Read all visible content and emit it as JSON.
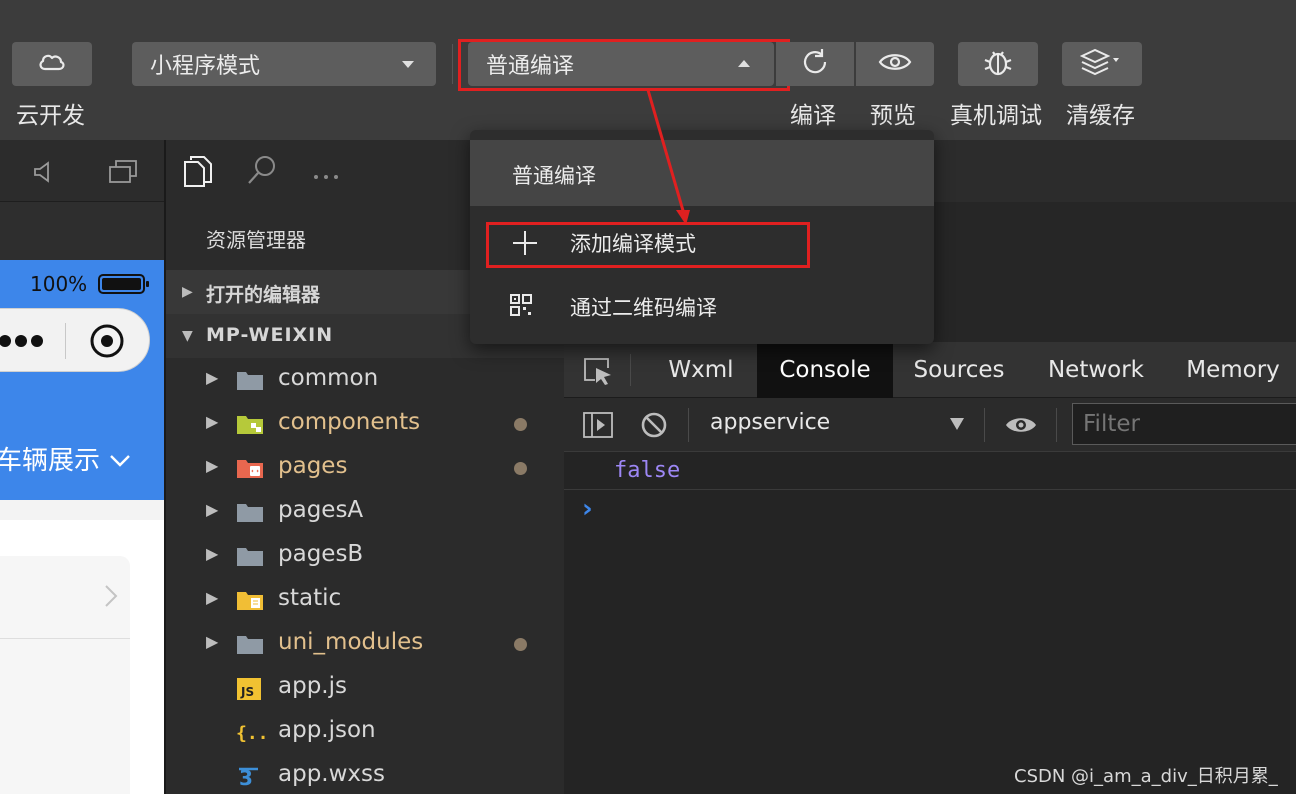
{
  "toolbar": {
    "cloud_dev_label": "云开发",
    "mode_select": "小程序模式",
    "compile_select": "普通编译",
    "compile_label": "编译",
    "preview_label": "预览",
    "debug_label": "真机调试",
    "cache_label": "清缓存"
  },
  "dropdown": {
    "header": "普通编译",
    "items": [
      {
        "label": "添加编译模式",
        "icon": "plus-icon"
      },
      {
        "label": "通过二维码编译",
        "icon": "qrcode-icon"
      }
    ]
  },
  "simulator": {
    "battery_percent": "100%",
    "header_title": "车辆展示",
    "header_icon": "chevron-down-icon"
  },
  "explorer": {
    "title": "资源管理器",
    "open_editors": "打开的编辑器",
    "project_name": "MP-WEIXIN",
    "files": [
      {
        "name": "common",
        "kind": "folder",
        "color": "#d8d8d8",
        "modified": false
      },
      {
        "name": "components",
        "kind": "folder-components",
        "color": "#e2c08d",
        "modified": true
      },
      {
        "name": "pages",
        "kind": "folder-pages",
        "color": "#e2c08d",
        "modified": true
      },
      {
        "name": "pagesA",
        "kind": "folder",
        "color": "#d8d8d8",
        "modified": false
      },
      {
        "name": "pagesB",
        "kind": "folder",
        "color": "#d8d8d8",
        "modified": false
      },
      {
        "name": "static",
        "kind": "folder-static",
        "color": "#d8d8d8",
        "modified": false
      },
      {
        "name": "uni_modules",
        "kind": "folder",
        "color": "#e2c08d",
        "modified": true
      },
      {
        "name": "app.js",
        "kind": "js-file",
        "color": "#d8d8d8",
        "modified": false
      },
      {
        "name": "app.json",
        "kind": "json-file",
        "color": "#d8d8d8",
        "modified": false
      },
      {
        "name": "app.wxss",
        "kind": "css-file",
        "color": "#d8d8d8",
        "modified": false
      }
    ]
  },
  "devtools": {
    "tabs": [
      "Wxml",
      "Console",
      "Sources",
      "Network",
      "Memory"
    ],
    "active_tab": "Console",
    "context_select": "appservice",
    "filter_placeholder": "Filter",
    "console_output": "false",
    "prompt": "›"
  },
  "colors": {
    "highlight_red": "#e02020",
    "sim_blue": "#3d86ea",
    "console_value": "#9d87f5",
    "prompt_blue": "#3d86ea"
  },
  "watermark": "CSDN @i_am_a_div_日积月累_"
}
